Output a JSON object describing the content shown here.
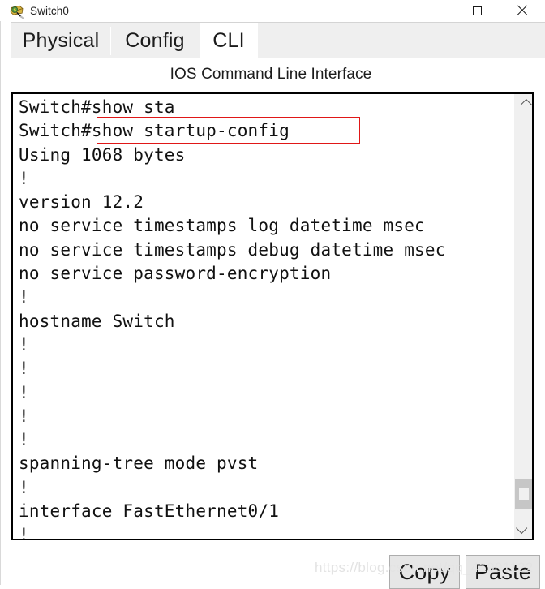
{
  "window": {
    "title": "Switch0",
    "app_icon": "packet-tracer-switch-icon",
    "controls": {
      "minimize": "minimize-icon",
      "maximize": "maximize-icon",
      "close": "close-icon"
    }
  },
  "tabs": [
    {
      "label": "Physical",
      "active": false
    },
    {
      "label": "Config",
      "active": false
    },
    {
      "label": "CLI",
      "active": true
    }
  ],
  "cli": {
    "header": "IOS Command Line Interface",
    "terminal_text": "Switch#show sta\nSwitch#show startup-config\nUsing 1068 bytes\n!\nversion 12.2\nno service timestamps log datetime msec\nno service timestamps debug datetime msec\nno service password-encryption\n!\nhostname Switch\n!\n!\n!\n!\n!\nspanning-tree mode pvst\n!\ninterface FastEthernet0/1\n!",
    "annotation": {
      "highlighted_text": "#show startup-config",
      "color": "#e01717"
    },
    "scrollbar": {
      "up_arrow": "chevron-up-icon",
      "down_arrow": "chevron-down-icon"
    }
  },
  "buttons": {
    "copy": "Copy",
    "paste": "Paste"
  },
  "watermark": "https://blog.csdn.net/qq_41901122"
}
